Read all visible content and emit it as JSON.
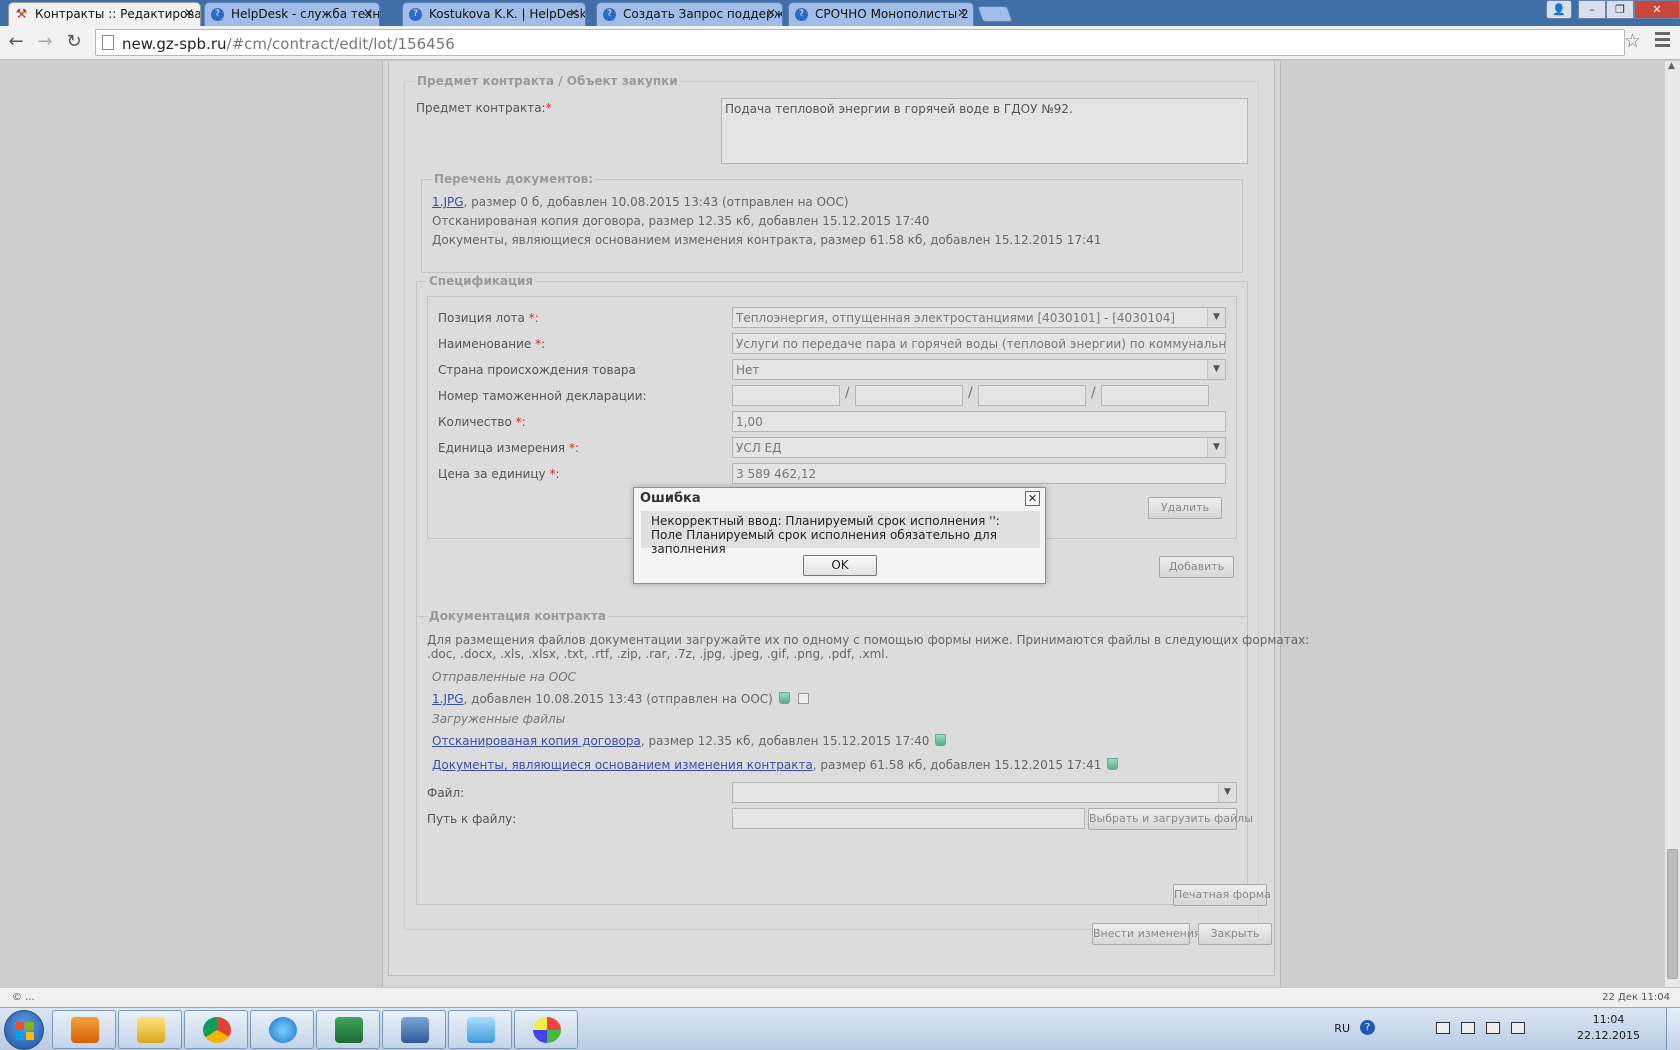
{
  "browser": {
    "tabs": [
      {
        "label": "Контракты :: Редактирова",
        "active": true
      },
      {
        "label": "HelpDesk - служба техни",
        "active": false
      },
      {
        "label": "Kostukova K.K. | HelpDesk",
        "active": false
      },
      {
        "label": "Создать Запрос поддерж",
        "active": false
      },
      {
        "label": "СРОЧНО Монополисты 2",
        "active": false
      }
    ],
    "url_host": "new.gz-spb.ru",
    "url_path": "/#cm/contract/edit/lot/156456",
    "tab_close_glyph": "✕"
  },
  "subject": {
    "legend": "Предмет контракта / Объект закупки",
    "label": "Предмет контракта:",
    "required_mark": "*",
    "value": "Подача тепловой энергии в горячей воде в ГДОУ №92."
  },
  "documents": {
    "legend": "Перечень документов:",
    "items": [
      {
        "link": "1.JPG",
        "text": ", размер 0 б, добавлен 10.08.2015 13:43 (отправлен на ООС)"
      },
      {
        "link": "",
        "text": "Отсканированая копия договора, размер 12.35 кб, добавлен 15.12.2015 17:40"
      },
      {
        "link": "",
        "text": "Документы, являющиеся основанием изменения контракта, размер 61.58 кб, добавлен 15.12.2015 17:41"
      }
    ]
  },
  "spec": {
    "legend": "Спецификация",
    "lot_position": {
      "label": "Позиция лота",
      "value": "Теплоэнергия, отпущенная электростанциями [4030101] - [4030104]"
    },
    "name": {
      "label": "Наименование",
      "value": "Услуги по передаче пара и горячей воды (тепловой энергии) по коммунальным тепл"
    },
    "country": {
      "label": "Страна происхождения товара",
      "value": "Нет"
    },
    "customs": {
      "label": "Номер таможенной декларации:",
      "separator": "/"
    },
    "quantity": {
      "label": "Количество",
      "value": "1,00"
    },
    "unit": {
      "label": "Единица измерения",
      "value": "УСЛ ЕД"
    },
    "price": {
      "label": "Цена за единицу",
      "value": "3 589 462,12"
    },
    "required_suffix": " *:",
    "delete_button": "Удалить",
    "add_button": "Добавить"
  },
  "contract_docs": {
    "legend": "Документация контракта",
    "intro": "Для размещения файлов документации загружайте их по одному с помощью формы ниже. Принимаются файлы в следующих форматах:",
    "formats": ".doc, .docx, .xls, .xlsx, .txt, .rtf, .zip, .rar, .7z, .jpg, .jpeg, .gif, .png, .pdf, .xml.",
    "sent_heading": "Отправленные на ООС",
    "sent_file_link": "1.JPG",
    "sent_file_info": ", добавлен 10.08.2015 13:43 (отправлен на ООС)",
    "uploaded_heading": "Загруженные файлы",
    "uploaded": [
      {
        "link": "Отсканированая копия договора",
        "info": ", размер 12.35 кб, добавлен 15.12.2015 17:40"
      },
      {
        "link": "Документы, являющиеся основанием изменения контракта",
        "info": ", размер 61.58 кб, добавлен 15.12.2015 17:41"
      }
    ],
    "file_label": "Файл:",
    "path_label": "Путь к файлу:",
    "upload_button": "Выбрать и загрузить файлы"
  },
  "actions": {
    "print_button": "Печатная форма",
    "apply_button": "Внести изменения",
    "close_button": "Закрыть"
  },
  "dialog": {
    "title": "Ошибка",
    "close_glyph": "✕",
    "line1": "Некорректный ввод: Планируемый срок исполнения '':",
    "line2": "Поле Планируемый срок исполнения обязательно для заполнения",
    "ok_button": "OK"
  },
  "statusbar": {
    "left": "© ...",
    "right": "22 Дек 11:04"
  },
  "taskbar": {
    "lang": "RU",
    "time": "11:04",
    "date": "22.12.2015"
  }
}
